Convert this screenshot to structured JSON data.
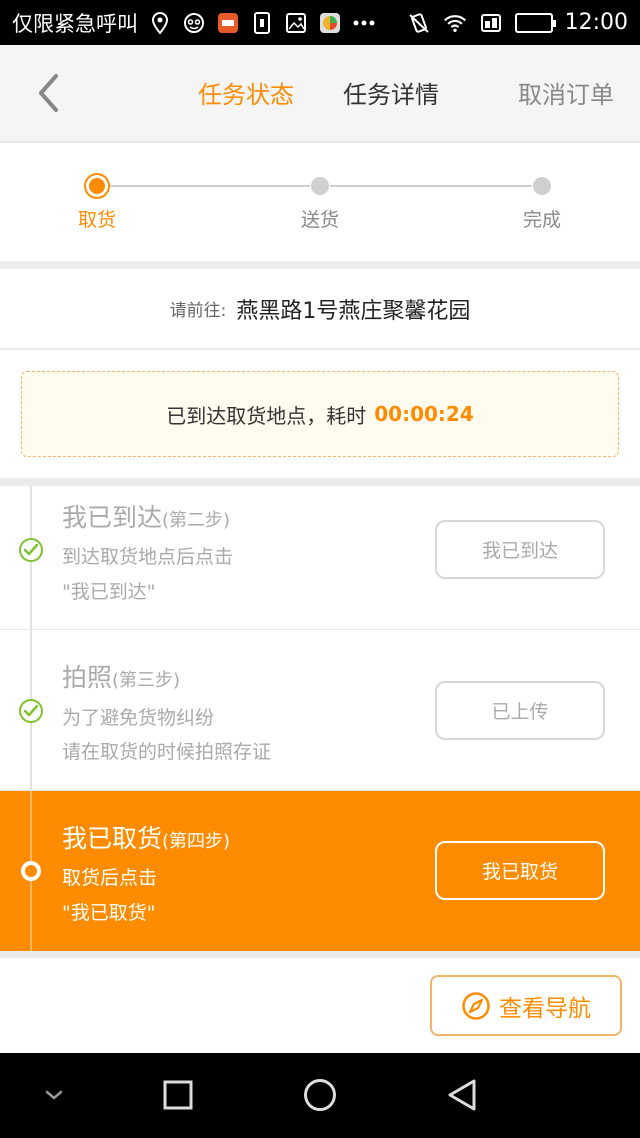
{
  "status_bar": {
    "carrier_text": "仅限紧急呼叫",
    "time": "12:00",
    "icons": [
      "location-icon",
      "face-icon",
      "app-icon",
      "sim-icon",
      "image-icon",
      "color-icon",
      "more-icon",
      "vibrate-icon",
      "wifi-icon",
      "data-icon",
      "battery-icon"
    ]
  },
  "header": {
    "tabs": [
      {
        "label": "任务状态",
        "active": true
      },
      {
        "label": "任务详情",
        "active": false
      }
    ],
    "cancel_label": "取消订单"
  },
  "progress": {
    "steps": [
      {
        "label": "取货",
        "active": true
      },
      {
        "label": "送货",
        "active": false
      },
      {
        "label": "完成",
        "active": false
      }
    ]
  },
  "destination": {
    "prefix": "请前往:",
    "address": "燕黑路1号燕庄聚馨花园"
  },
  "notice": {
    "text": "已到达取货地点，耗时",
    "timer": "00:00:24"
  },
  "steps": [
    {
      "title": "我已到达",
      "sub": "(第二步)",
      "desc1": "到达取货地点后点击",
      "desc2": "\"我已到达\"",
      "button": "我已到达",
      "state": "done"
    },
    {
      "title": "拍照",
      "sub": "(第三步)",
      "desc1": "为了避免货物纠纷",
      "desc2": "请在取货的时候拍照存证",
      "button": "已上传",
      "state": "done"
    },
    {
      "title": "我已取货",
      "sub": "(第四步)",
      "desc1": "取货后点击",
      "desc2": "\"我已取货\"",
      "button": "我已取货",
      "state": "current"
    }
  ],
  "navigation_button": "查看导航",
  "colors": {
    "accent": "#ff8c00",
    "done_green": "#7cc22d",
    "notice_bg": "#fffbee"
  }
}
